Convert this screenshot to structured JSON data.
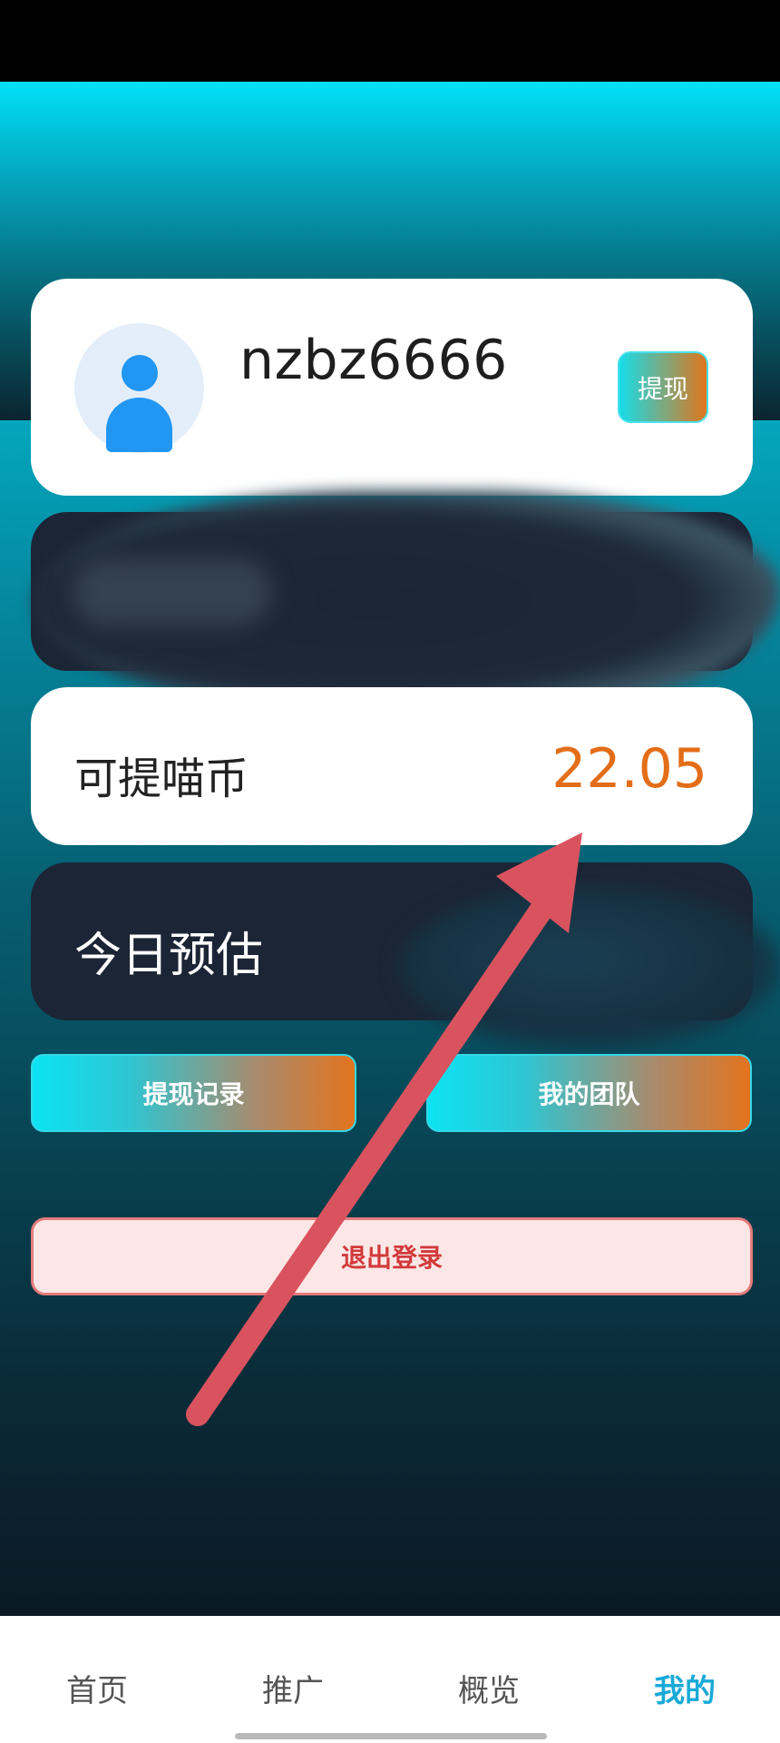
{
  "profile": {
    "username": "nzbz6666",
    "withdraw_label": "提现",
    "avatar_icon": "user-avatar-icon"
  },
  "coins": {
    "label": "可提喵币",
    "value": "22.05"
  },
  "today": {
    "label": "今日预估"
  },
  "actions": {
    "withdraw_history_label": "提现记录",
    "my_team_label": "我的团队",
    "logout_label": "退出登录"
  },
  "tabs": [
    {
      "label": "首页",
      "active": false
    },
    {
      "label": "推广",
      "active": false
    },
    {
      "label": "概览",
      "active": false
    },
    {
      "label": "我的",
      "active": true
    }
  ],
  "colors": {
    "accent": "#1aa9d7",
    "coin_value": "#e36d18",
    "logout_text": "#d13a3a",
    "annotation_arrow": "#d9535f"
  }
}
